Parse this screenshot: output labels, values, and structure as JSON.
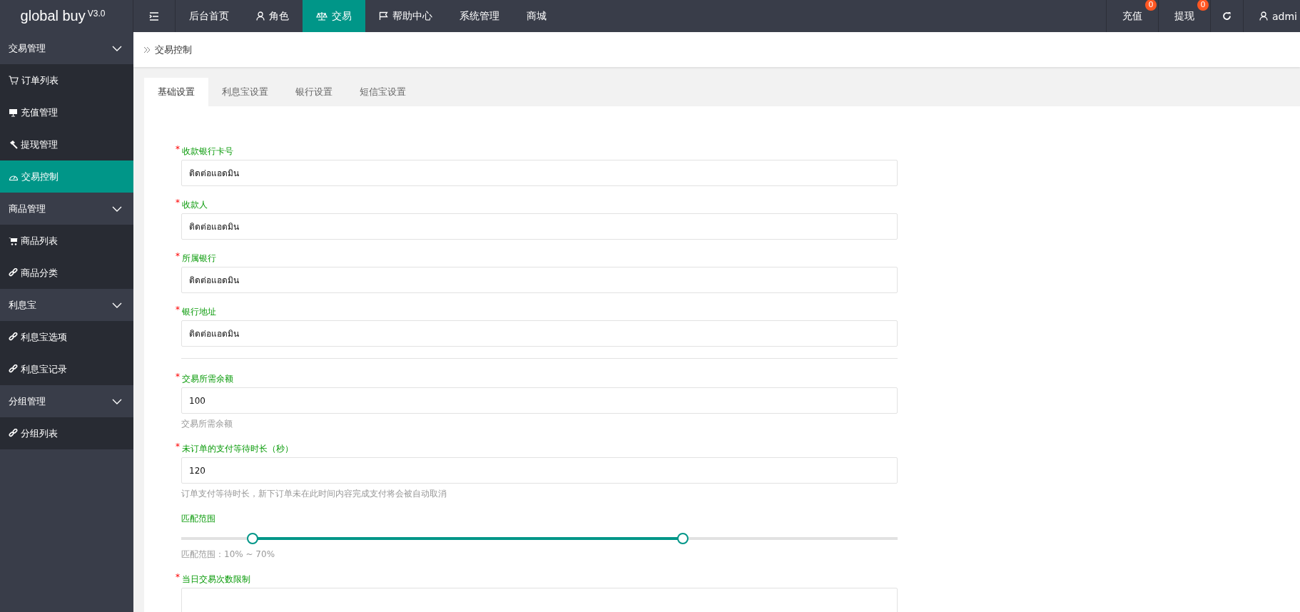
{
  "brand": {
    "name": "global buy",
    "version": "V3.0"
  },
  "top_nav": [
    {
      "label": "后台首页",
      "selected": false
    },
    {
      "label": "角色",
      "selected": false
    },
    {
      "label": "交易",
      "selected": true
    },
    {
      "label": "帮助中心",
      "selected": false
    },
    {
      "label": "系统管理",
      "selected": false
    },
    {
      "label": "商城",
      "selected": false
    }
  ],
  "top_right": {
    "actions": [
      {
        "label": "充值",
        "badge": "0"
      },
      {
        "label": "提现",
        "badge": "0"
      }
    ],
    "user": "admi"
  },
  "sidebar": {
    "groups": [
      {
        "label": "交易管理",
        "expanded": true,
        "children": [
          {
            "label": "订单列表",
            "selected": false
          },
          {
            "label": "充值管理",
            "selected": false
          },
          {
            "label": "提现管理",
            "selected": false
          },
          {
            "label": "交易控制",
            "selected": true
          }
        ]
      },
      {
        "label": "商品管理",
        "expanded": true,
        "children": [
          {
            "label": "商品列表",
            "selected": false
          },
          {
            "label": "商品分类",
            "selected": false
          }
        ]
      },
      {
        "label": "利息宝",
        "expanded": true,
        "children": [
          {
            "label": "利息宝选项",
            "selected": false
          },
          {
            "label": "利息宝记录",
            "selected": false
          }
        ]
      },
      {
        "label": "分组管理",
        "expanded": true,
        "children": [
          {
            "label": "分组列表",
            "selected": false
          }
        ]
      }
    ]
  },
  "breadcrumb": "交易控制",
  "tabs": [
    {
      "label": "基础设置",
      "selected": true
    },
    {
      "label": "利息宝设置",
      "selected": false
    },
    {
      "label": "银行设置",
      "selected": false
    },
    {
      "label": "短信宝设置",
      "selected": false
    }
  ],
  "form": [
    {
      "kind": "input",
      "required_mark": "*",
      "label": "收款银行卡号",
      "value": "ติดต่อแอดมิน"
    },
    {
      "kind": "input",
      "required_mark": "*",
      "label": "收款人",
      "value": "ติดต่อแอดมิน"
    },
    {
      "kind": "input",
      "required_mark": "*",
      "label": "所属银行",
      "value": "ติดต่อแอดมิน"
    },
    {
      "kind": "input",
      "required_mark": "*",
      "label": "银行地址",
      "value": "ติดต่อแอดมิน"
    },
    {
      "kind": "divider"
    },
    {
      "kind": "input",
      "required_mark": "*",
      "label": "交易所需余额",
      "value": "100",
      "help": "交易所需余额"
    },
    {
      "kind": "input",
      "required_mark": "*",
      "label": "未订单的支付等待时长（秒）",
      "value": "120",
      "help": "订单支付等待时长，新下订单未在此时间内容完成支付将会被自动取消"
    },
    {
      "kind": "range",
      "label": "匹配范围",
      "handles": [
        {
          "level": 0.1
        },
        {
          "level": 0.7
        }
      ],
      "help": "匹配范围：10% ~ 70%"
    },
    {
      "kind": "input",
      "required_mark": "*",
      "label": "当日交易次数限制"
    }
  ]
}
